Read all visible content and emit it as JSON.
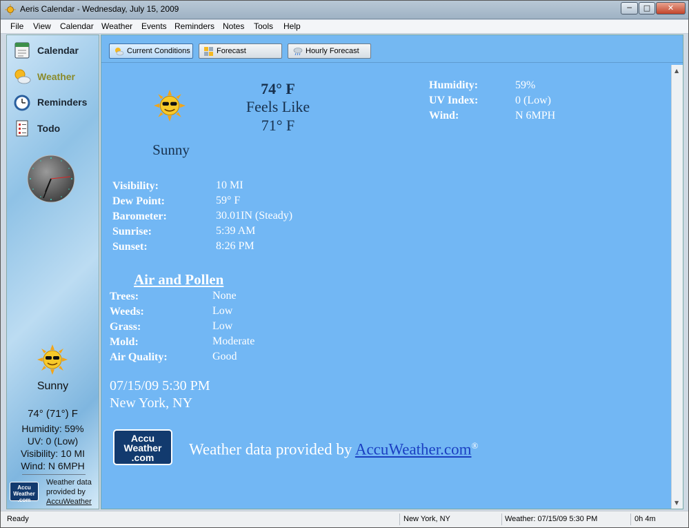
{
  "window": {
    "title": "Aeris Calendar - Wednesday, July 15, 2009",
    "min": "─",
    "max": "□",
    "close": "✕"
  },
  "menu": [
    "File",
    "View",
    "Calendar",
    "Weather",
    "Events",
    "Reminders",
    "Notes",
    "Tools",
    "Help"
  ],
  "sidebar": {
    "items": [
      {
        "label": "Calendar",
        "icon": "calendar-icon"
      },
      {
        "label": "Weather",
        "icon": "weather-icon",
        "active": true
      },
      {
        "label": "Reminders",
        "icon": "alarm-clock-icon"
      },
      {
        "label": "Todo",
        "icon": "checklist-icon"
      }
    ],
    "weather": {
      "condition": "Sunny",
      "temp": "74° (71°) F",
      "humidity": "Humidity: 59%",
      "uv": "UV: 0 (Low)",
      "visibility": "Visibility: 10 MI",
      "wind": "Wind: N 6MPH",
      "logo": [
        "Accu",
        "Weather",
        ".com"
      ],
      "provided": "Weather data provided by",
      "provided_link": "AccuWeather"
    }
  },
  "toolbar": {
    "current": "Current Conditions",
    "forecast": "Forecast",
    "hourly": "Hourly Forecast"
  },
  "current": {
    "temp": "74° F",
    "feels_label": "Feels Like",
    "feels_value": "71° F",
    "condition": "Sunny",
    "right": [
      {
        "label": "Humidity:",
        "value": "59%"
      },
      {
        "label": "UV Index:",
        "value": "0 (Low)"
      },
      {
        "label": "Wind:",
        "value": "N 6MPH"
      }
    ],
    "details": [
      {
        "label": "Visibility:",
        "value": "10 MI"
      },
      {
        "label": "Dew Point:",
        "value": "59° F"
      },
      {
        "label": "Barometer:",
        "value": "30.01IN (Steady)"
      },
      {
        "label": "Sunrise:",
        "value": "5:39 AM"
      },
      {
        "label": "Sunset:",
        "value": "8:26 PM"
      }
    ],
    "air_title": "Air and Pollen",
    "air": [
      {
        "label": "Trees:",
        "value": "None"
      },
      {
        "label": "Weeds:",
        "value": "Low"
      },
      {
        "label": "Grass:",
        "value": "Low"
      },
      {
        "label": "Mold:",
        "value": "Moderate"
      },
      {
        "label": "Air Quality:",
        "value": "Good"
      }
    ],
    "timestamp": "07/15/09 5:30 PM",
    "location": "New York, NY",
    "logo": [
      "Accu",
      "Weather",
      ".com"
    ],
    "credit_prefix": "Weather data provided by ",
    "credit_link": "AccuWeather.com",
    "credit_mark": "®"
  },
  "status": {
    "left": "Ready",
    "location": "New York, NY",
    "weather": "Weather: 07/15/09 5:30 PM",
    "elapsed": "0h 4m"
  },
  "colors": {
    "main_bg": "#72b7f4",
    "link": "#1a3fc2",
    "active_nav": "#8a8a2a"
  }
}
